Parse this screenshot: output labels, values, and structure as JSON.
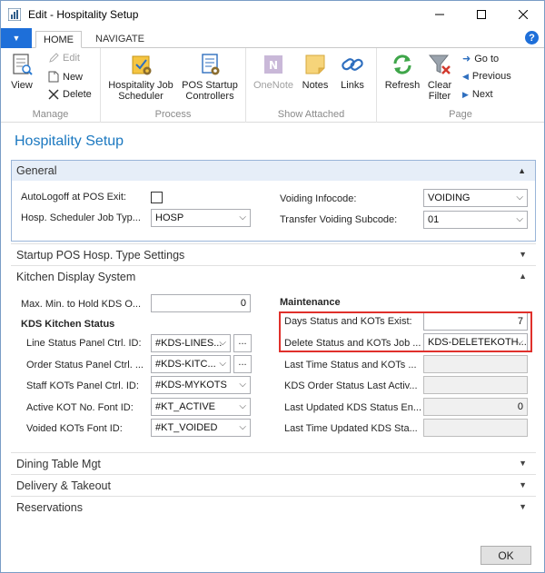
{
  "window": {
    "title": "Edit - Hospitality Setup"
  },
  "ribbon": {
    "tabs": [
      {
        "label": "HOME"
      },
      {
        "label": "NAVIGATE"
      }
    ],
    "groups": {
      "manage": {
        "label": "Manage",
        "view": "View",
        "edit": "Edit",
        "new": "New",
        "delete": "Delete"
      },
      "process": {
        "label": "Process",
        "job_scheduler_1": "Hospitality Job",
        "job_scheduler_2": "Scheduler",
        "pos_startup_1": "POS Startup",
        "pos_startup_2": "Controllers"
      },
      "attached": {
        "label": "Show Attached",
        "onenote": "OneNote",
        "notes": "Notes",
        "links": "Links"
      },
      "page": {
        "label": "Page",
        "refresh": "Refresh",
        "clear_filter_1": "Clear",
        "clear_filter_2": "Filter",
        "goto": "Go to",
        "previous": "Previous",
        "next": "Next"
      }
    }
  },
  "page": {
    "title": "Hospitality Setup"
  },
  "general": {
    "header": "General",
    "autologoff_label": "AutoLogoff at POS Exit:",
    "scheduler_label": "Hosp. Scheduler Job Typ...",
    "scheduler_value": "HOSP",
    "voiding_infocode_label": "Voiding Infocode:",
    "voiding_infocode_value": "VOIDING",
    "transfer_subcode_label": "Transfer Voiding Subcode:",
    "transfer_subcode_value": "01"
  },
  "fasttabs": {
    "startup": "Startup POS Hosp. Type Settings",
    "kds": "Kitchen Display System",
    "dining": "Dining Table Mgt",
    "delivery": "Delivery & Takeout",
    "reservations": "Reservations"
  },
  "kds": {
    "max_min_label": "Max. Min. to Hold KDS O...",
    "max_min_value": "0",
    "kitchen_status_heading": "KDS Kitchen Status",
    "line_status_label": "Line Status Panel Ctrl. ID:",
    "line_status_value": "#KDS-LINES...",
    "order_status_label": "Order Status Panel Ctrl. ...",
    "order_status_value": "#KDS-KITC...",
    "staff_kots_label": "Staff KOTs Panel Ctrl. ID:",
    "staff_kots_value": "#KDS-MYKOTS",
    "active_font_label": "Active KOT No. Font ID:",
    "active_font_value": "#KT_ACTIVE",
    "voided_font_label": "Voided KOTs Font ID:",
    "voided_font_value": "#KT_VOIDED",
    "assist_button": "...",
    "maintenance_heading": "Maintenance",
    "days_exist_label": "Days Status and KOTs Exist:",
    "days_exist_value": "7",
    "delete_job_label": "Delete Status and KOTs Job ...",
    "delete_job_value": "KDS-DELETEKOTH...",
    "last_time_label": "Last Time Status and KOTs ...",
    "kds_order_last_label": "KDS Order Status Last Activ...",
    "last_updated_label": "Last Updated KDS Status En...",
    "last_updated_value": "0",
    "last_time_updated_label": "Last Time Updated KDS Sta..."
  },
  "footer": {
    "ok": "OK"
  },
  "colors": {
    "accent": "#1e6fd9",
    "title_blue": "#1b78c0",
    "highlight_red": "#e0302b"
  }
}
